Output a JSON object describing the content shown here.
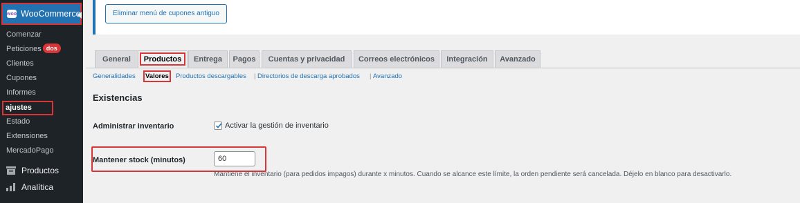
{
  "sidebar": {
    "header_title": "WooCommerce",
    "logo_text": "woo",
    "items": [
      {
        "label": "Comenzar"
      },
      {
        "label": "Peticiones",
        "badge": "dos"
      },
      {
        "label": "Clientes"
      },
      {
        "label": "Cupones"
      },
      {
        "label": "Informes"
      },
      {
        "label": "ajustes"
      },
      {
        "label": "Estado"
      },
      {
        "label": "Extensiones"
      },
      {
        "label": "MercadoPago"
      }
    ],
    "main_items": [
      {
        "label": "Productos",
        "icon": "products-icon"
      },
      {
        "label": "Analítica",
        "icon": "analytics-icon"
      }
    ]
  },
  "top": {
    "button_label": "Eliminar menú de cupones antiguo"
  },
  "tabs": [
    "General",
    "Productos",
    "Entrega",
    "Pagos",
    "Cuentas y privacidad",
    "Correos electrónicos",
    "Integración",
    "Avanzado"
  ],
  "subnav": {
    "items": [
      "Generalidades",
      "Valores",
      "Productos descargables",
      "Directorios de descarga aprobados",
      "Avanzado"
    ],
    "separator": "|"
  },
  "section_title": "Existencias",
  "fields": {
    "admin_label": "Administrar inventario",
    "admin_checkbox_label": "Activar la gestión de inventario",
    "stock_label": "Mantener stock (minutos)",
    "stock_value": "60",
    "stock_description": "Mantiene el inventario (para pedidos impagos) durante x minutos. Cuando se alcance este límite, la orden pendiente será cancelada. Déjelo en blanco para desactivarlo."
  },
  "colors": {
    "sidebar_bg": "#1d2327",
    "accent": "#2271b1",
    "highlight": "#d63638"
  }
}
